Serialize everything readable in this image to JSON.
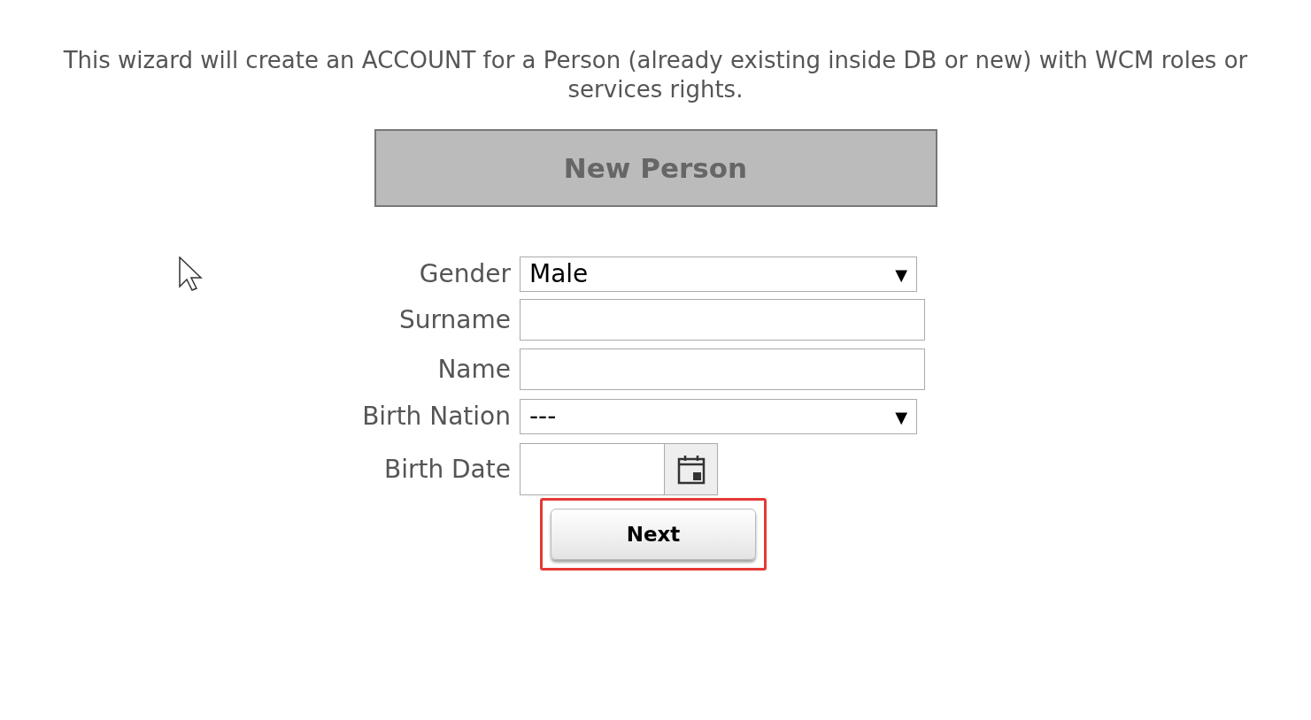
{
  "intro": "This wizard will create an ACCOUNT for a Person (already existing inside DB or new) with WCM roles or services rights.",
  "title": "New Person",
  "fields": [
    {
      "kind": "select",
      "label": "Gender",
      "value": "Male",
      "arrow": "▼"
    },
    {
      "kind": "text",
      "label": "Surname"
    },
    {
      "kind": "text",
      "label": "Name"
    },
    {
      "kind": "select",
      "label": "Birth Nation",
      "value": "---",
      "arrow": "▼"
    },
    {
      "kind": "date",
      "label": "Birth Date"
    }
  ],
  "next_button": {
    "label": "Next",
    "highlighted": true
  }
}
